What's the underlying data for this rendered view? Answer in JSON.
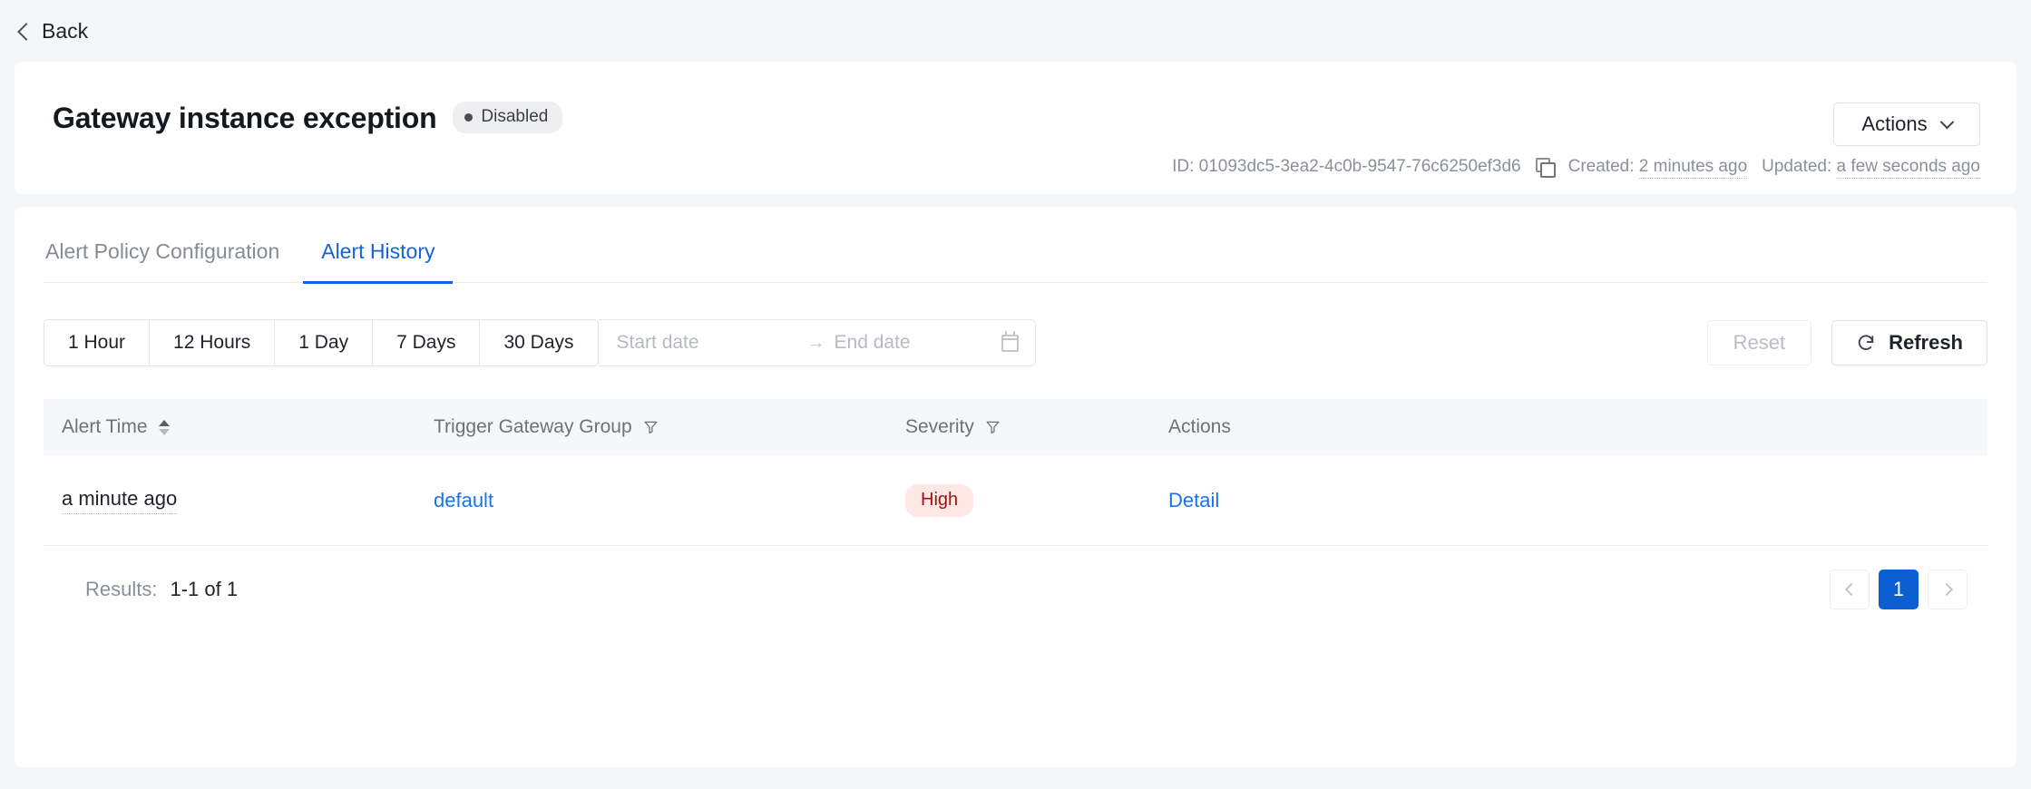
{
  "back": {
    "label": "Back",
    "icon": "chevron-left-icon"
  },
  "header": {
    "title": "Gateway instance exception",
    "status": {
      "label": "Disabled",
      "dot_color": "#4a4f57",
      "bg_color": "#efeff1"
    },
    "actions_button": {
      "label": "Actions",
      "icon": "chevron-down-icon"
    },
    "meta": {
      "id_label": "ID:",
      "id_value": "01093dc5-3ea2-4c0b-9547-76c6250ef3d6",
      "copy_icon": "copy-icon",
      "created_label": "Created:",
      "created_value": "2 minutes ago",
      "updated_label": "Updated:",
      "updated_value": "a few seconds ago"
    }
  },
  "tabs": [
    {
      "label": "Alert Policy Configuration",
      "active": false
    },
    {
      "label": "Alert History",
      "active": true
    }
  ],
  "filters": {
    "ranges": [
      "1 Hour",
      "12 Hours",
      "1 Day",
      "7 Days",
      "30 Days"
    ],
    "date_range": {
      "start_placeholder": "Start date",
      "start_value": "",
      "separator": "→",
      "end_placeholder": "End date",
      "end_value": "",
      "calendar_icon": "calendar-icon"
    },
    "reset_label": "Reset",
    "refresh_label": "Refresh",
    "refresh_icon": "refresh-icon"
  },
  "table": {
    "columns": [
      {
        "label": "Alert Time",
        "icon": "sort-icon"
      },
      {
        "label": "Trigger Gateway Group",
        "icon": "filter-icon"
      },
      {
        "label": "Severity",
        "icon": "filter-icon"
      },
      {
        "label": "Actions",
        "icon": ""
      }
    ],
    "rows": [
      {
        "alert_time": "a minute ago",
        "trigger_gateway_group": "default",
        "severity": "High",
        "severity_bg": "#fde8e6",
        "severity_color": "#9c1111",
        "action_label": "Detail"
      }
    ]
  },
  "footer": {
    "results_label": "Results:",
    "results_value": "1-1 of 1",
    "pagination": {
      "prev_icon": "chevron-left-icon",
      "next_icon": "chevron-right-icon",
      "current_page": "1"
    }
  },
  "colors": {
    "accent": "#1463d8",
    "page_active": "#0b5fd0",
    "link": "#1a73e8"
  }
}
